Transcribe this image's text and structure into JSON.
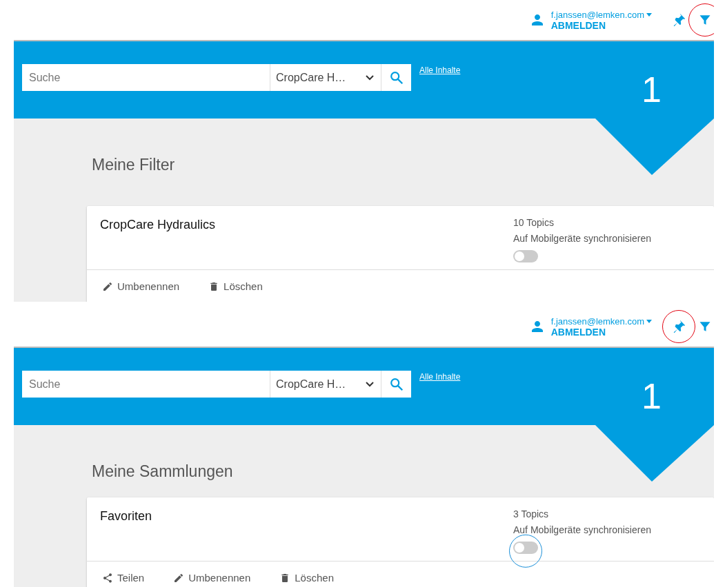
{
  "panels": [
    {
      "user": {
        "email": "f.janssen@lemken.com",
        "logout": "ABMELDEN"
      },
      "search": {
        "placeholder": "Suche",
        "scope": "CropCare H…"
      },
      "all_content_link": "Alle Inhalte",
      "counter": "1",
      "heading": "Meine Filter",
      "filter_annotation": {
        "color": "#e30613"
      },
      "cards": [
        {
          "title": "CropCare Hydraulics",
          "topics": "10 Topics",
          "sync_label": "Auf Mobilgeräte synchronisieren",
          "sync_on": false,
          "actions": [
            {
              "kind": "rename",
              "label": "Umbenennen"
            },
            {
              "kind": "delete",
              "label": "Löschen"
            }
          ]
        }
      ]
    },
    {
      "user": {
        "email": "f.janssen@lemken.com",
        "logout": "ABMELDEN"
      },
      "search": {
        "placeholder": "Suche",
        "scope": "CropCare H…"
      },
      "all_content_link": "Alle Inhalte",
      "counter": "1",
      "heading": "Meine Sammlungen",
      "pin_annotation": {
        "color": "#e30613"
      },
      "cards": [
        {
          "title": "Favoriten",
          "topics": "3 Topics",
          "sync_label": "Auf Mobilgeräte synchronisieren",
          "sync_on": false,
          "sync_annotation": {
            "color": "#1a8fd8"
          },
          "actions": [
            {
              "kind": "share",
              "label": "Teilen"
            },
            {
              "kind": "rename",
              "label": "Umbenennen"
            },
            {
              "kind": "delete",
              "label": "Löschen"
            }
          ]
        }
      ]
    }
  ]
}
